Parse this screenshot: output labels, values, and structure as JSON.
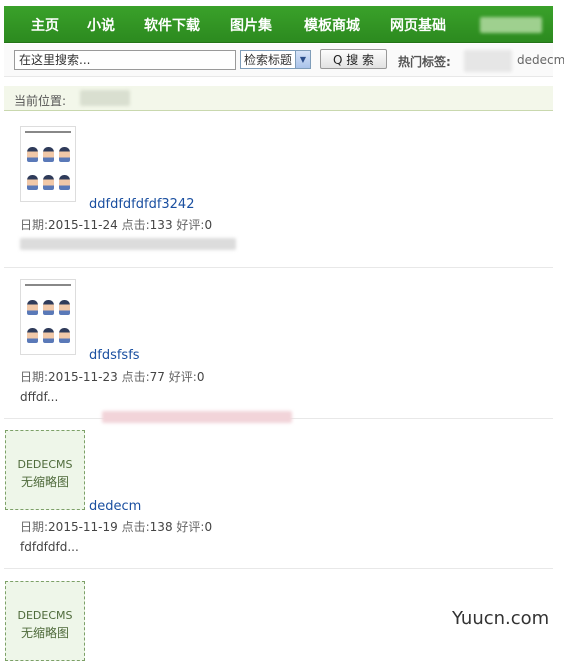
{
  "nav": {
    "items": [
      "主页",
      "小说",
      "软件下载",
      "图片集",
      "模板商城",
      "网页基础"
    ]
  },
  "search": {
    "placeholder": "在这里搜索...",
    "select_value": "检索标题",
    "button_label": "Q 搜 索",
    "hot_label": "热门标签:",
    "hot_tag": "dedecm"
  },
  "breadcrumb": {
    "label": "当前位置:"
  },
  "articles": [
    {
      "title": "ddfdfdfdfdf3242",
      "date_label": "日期:",
      "date": "2015-11-24",
      "clicks_label": "点击:",
      "clicks": "133",
      "good_label": "好评:",
      "good": "0",
      "description": ""
    },
    {
      "title": "dfdsfsfs",
      "date_label": "日期:",
      "date": "2015-11-23",
      "clicks_label": "点击:",
      "clicks": "77",
      "good_label": "好评:",
      "good": "0",
      "description": "dffdf..."
    },
    {
      "title": "dedecm",
      "date_label": "日期:",
      "date": "2015-11-19",
      "clicks_label": "点击:",
      "clicks": "138",
      "good_label": "好评:",
      "good": "0",
      "description": "fdfdfdfd..."
    }
  ],
  "no_thumb": {
    "line1": "DEDECMS",
    "line2": "无缩略图"
  },
  "watermark": "Yuucn.com",
  "colors": {
    "nav_green": "#2c8a1f",
    "link_blue": "#1a4fa0"
  }
}
